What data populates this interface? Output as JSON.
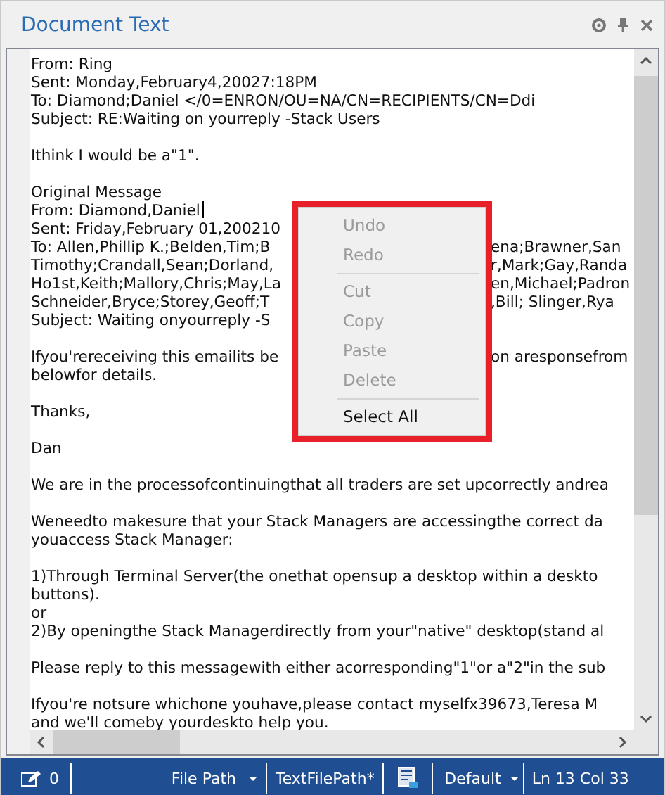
{
  "panel": {
    "title": "Document Text"
  },
  "lines": [
    {
      "kind": "text",
      "text": "From: Ring"
    },
    {
      "kind": "text",
      "text": "Sent: Monday,February4,20027:18PM"
    },
    {
      "kind": "text",
      "text": "To: Diamond;Daniel </0=ENRON/OU=NA/CN=RECIPIENTS/CN=Ddi"
    },
    {
      "kind": "text",
      "text": "Subject: RE:Waiting on yourreply -Stack Users"
    },
    {
      "kind": "blank"
    },
    {
      "kind": "text",
      "text": "Ithink I would be a\"1\"."
    },
    {
      "kind": "blank"
    },
    {
      "kind": "text",
      "text": "Original Message"
    },
    {
      "kind": "text",
      "text": "From: Diamond,Daniel",
      "caret": true
    },
    {
      "kind": "text",
      "text": "Sent: Friday,February 01,200210"
    },
    {
      "kind": "text",
      "text": "To: Allen,Phillip K.;Belden,Tim;B",
      "right": "ena;Brawner,San"
    },
    {
      "kind": "text",
      "text": "Timothy;Crandall,Sean;Dorland,",
      "right": "r,Mark;Gay,Randa"
    },
    {
      "kind": "text",
      "text": "Ho1st,Keith;Mallory,Chris;May,La",
      "right": "en,Michael;Padron"
    },
    {
      "kind": "text",
      "text": "Schneider,Bryce;Storey,Geoff;T",
      "right": ",Bill; Slinger,Rya"
    },
    {
      "kind": "text",
      "text": "Subject: Waiting onyourreply -S"
    },
    {
      "kind": "blank"
    },
    {
      "kind": "text",
      "text": "Ifyou'rereceiving this emailits be",
      "right": "on aresponsefrom"
    },
    {
      "kind": "text",
      "text": "belowfor details."
    },
    {
      "kind": "blank"
    },
    {
      "kind": "text",
      "text": "Thanks,"
    },
    {
      "kind": "blank"
    },
    {
      "kind": "text",
      "text": "Dan"
    },
    {
      "kind": "blank"
    },
    {
      "kind": "text",
      "text": "We are in the processofcontinuingthat all traders are set upcorrectly andrea"
    },
    {
      "kind": "blank"
    },
    {
      "kind": "text",
      "text": "Weneedto makesure that your Stack Managers are accessingthe correct da"
    },
    {
      "kind": "text",
      "text": "youaccess Stack Manager:"
    },
    {
      "kind": "blank"
    },
    {
      "kind": "text",
      "text": "1)Through Terminal Server(the onethat opensup a desktop within a deskto"
    },
    {
      "kind": "text",
      "text": "buttons)."
    },
    {
      "kind": "text",
      "text": "or"
    },
    {
      "kind": "text",
      "text": "2)By openingthe Stack Managerdirectly from your\"native\" desktop(stand al"
    },
    {
      "kind": "blank"
    },
    {
      "kind": "text",
      "text": "Please reply to this messagewith either acorresponding\"1\"or a\"2\"in the sub"
    },
    {
      "kind": "blank"
    },
    {
      "kind": "text",
      "text": "Ifyou're notsure whichone youhave,please contact myselfx39673,Teresa M"
    },
    {
      "kind": "text",
      "text": "and we'll comeby yourdeskto help you."
    }
  ],
  "context_menu": {
    "highlighted": true,
    "items": [
      {
        "kind": "item",
        "label": "Undo",
        "disabled": true
      },
      {
        "kind": "item",
        "label": "Redo",
        "disabled": true
      },
      {
        "kind": "separator"
      },
      {
        "kind": "item",
        "label": "Cut",
        "disabled": true
      },
      {
        "kind": "item",
        "label": "Copy",
        "disabled": true
      },
      {
        "kind": "item",
        "label": "Paste",
        "disabled": true
      },
      {
        "kind": "item",
        "label": "Delete",
        "disabled": true
      },
      {
        "kind": "separator"
      },
      {
        "kind": "item",
        "label": "Select All",
        "disabled": false
      }
    ]
  },
  "status_bar": {
    "edit_count": "0",
    "path_mode": "File Path",
    "file_name": "TextFilePath*",
    "encoding": "Default",
    "position": "Ln 13 Col 33"
  }
}
